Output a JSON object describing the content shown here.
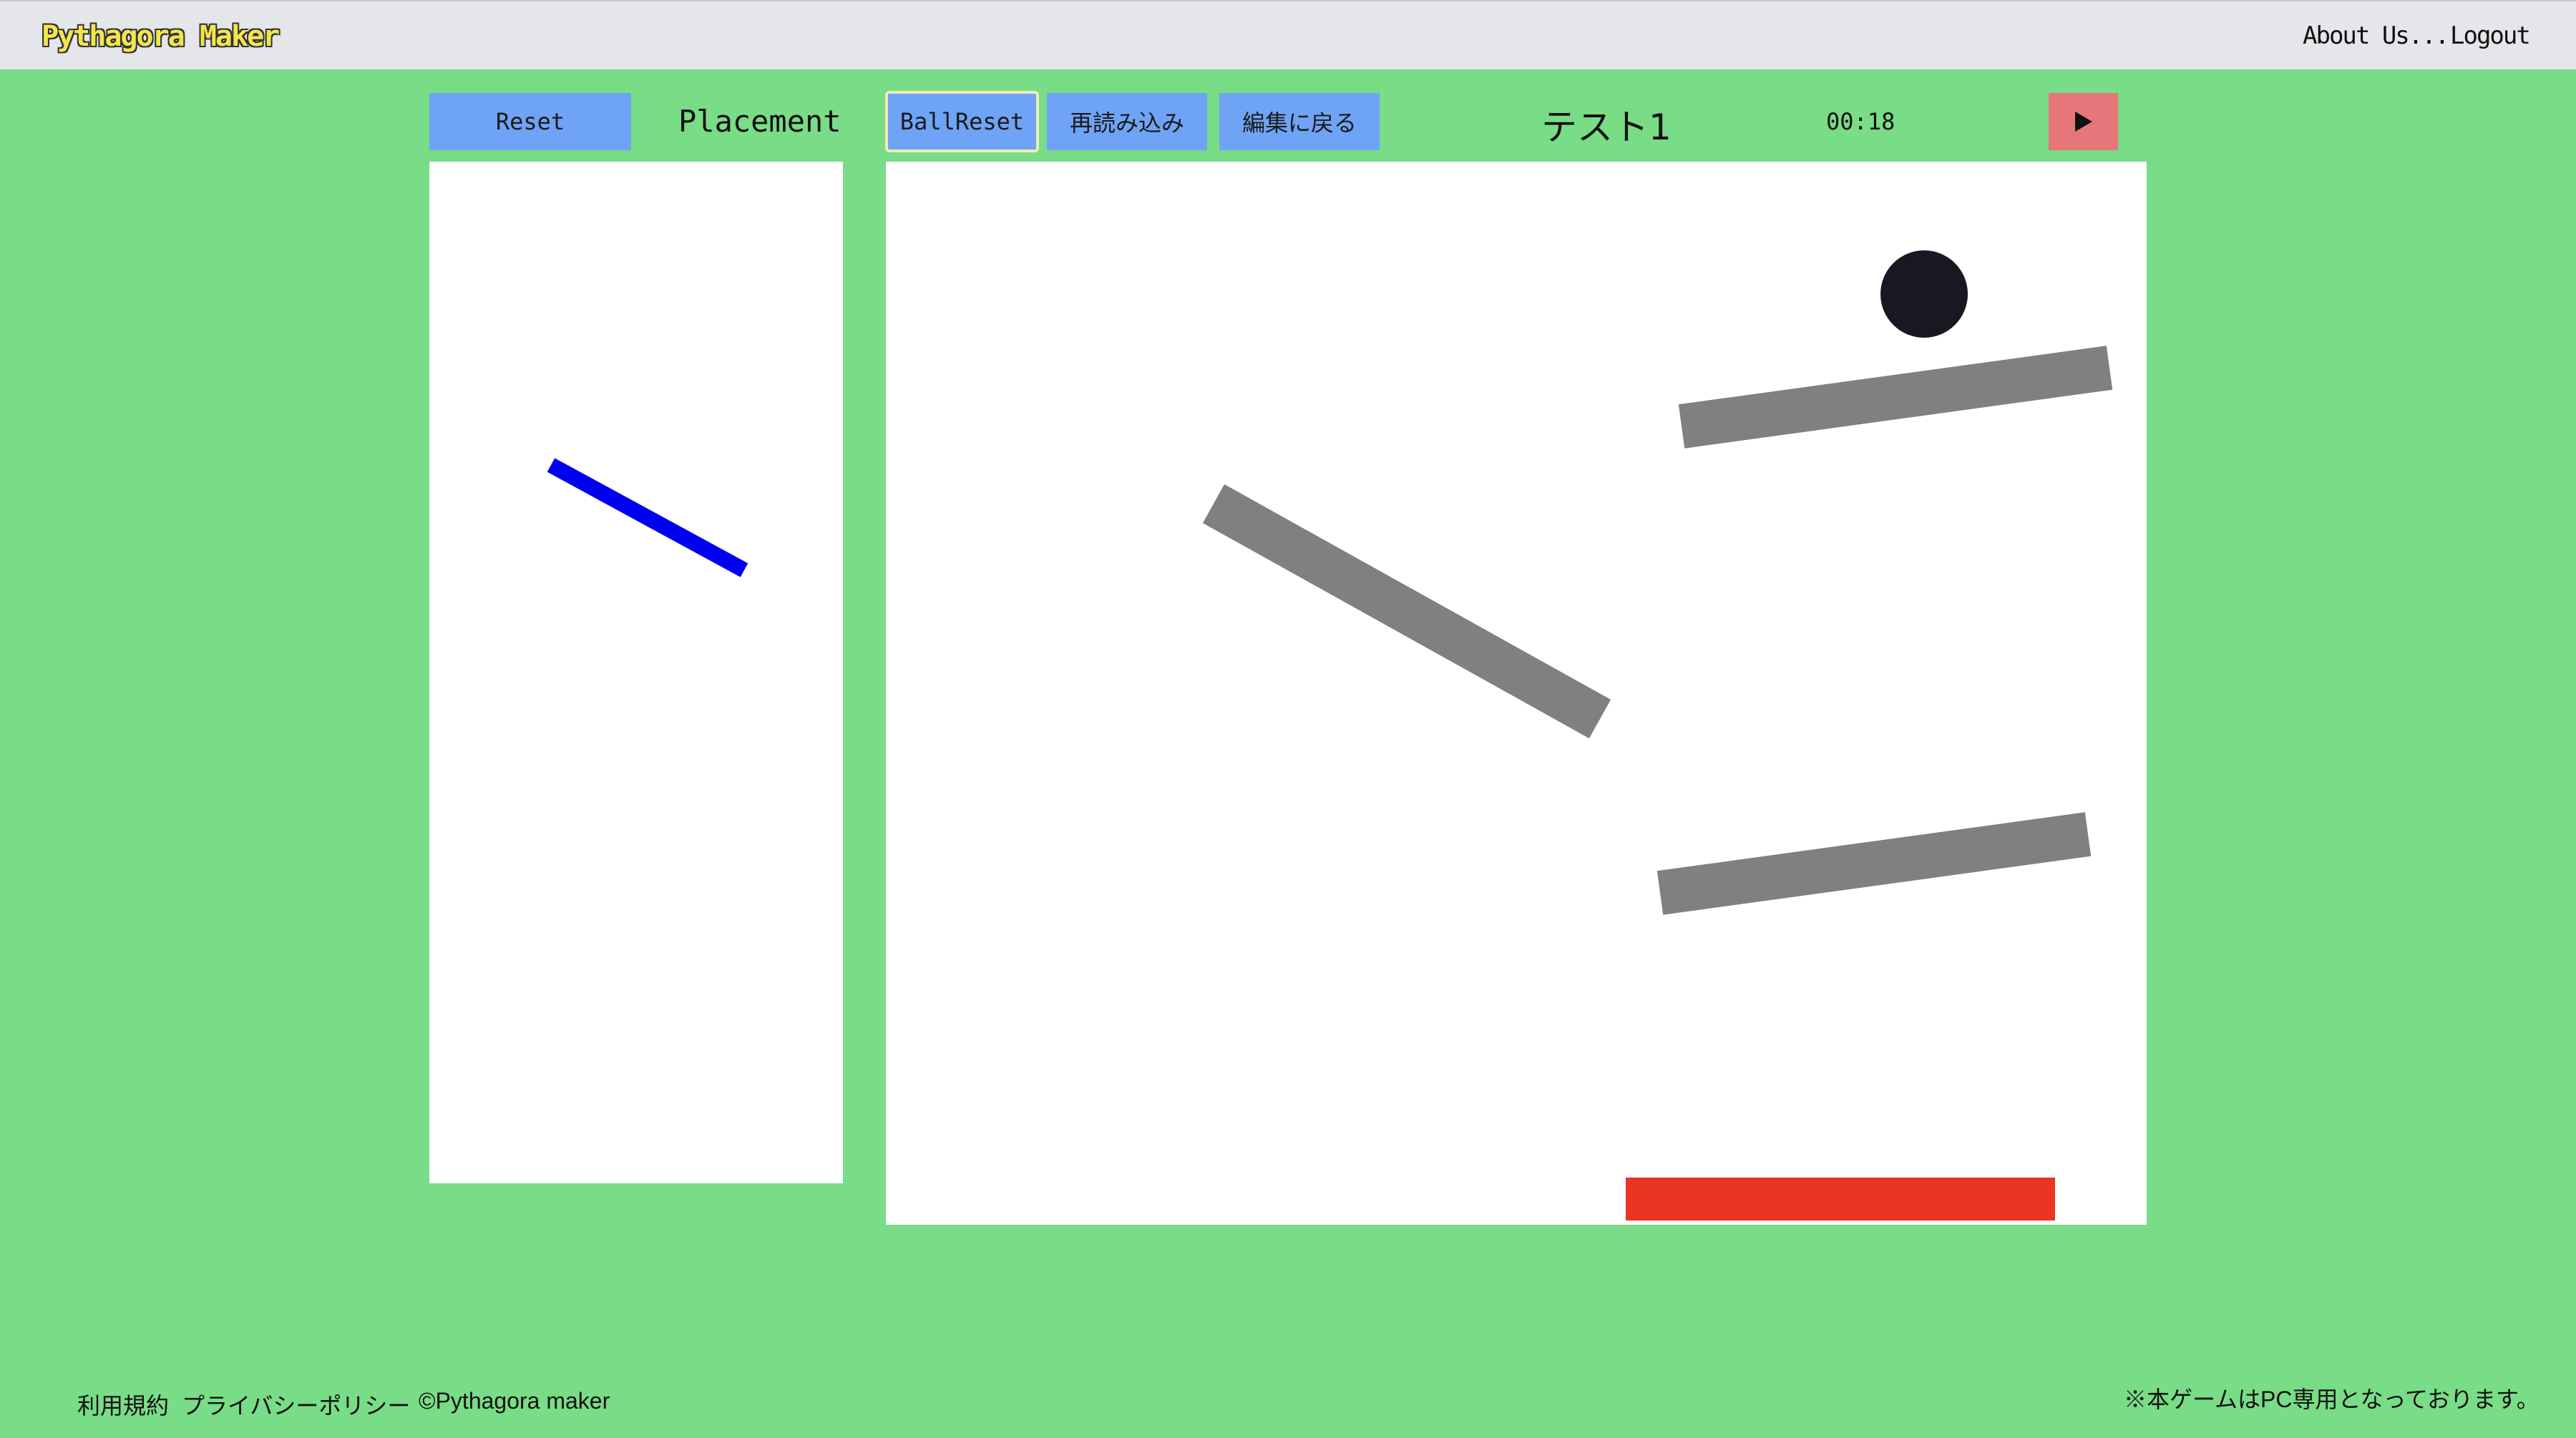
{
  "header": {
    "logo": "Pythagora Maker",
    "nav": {
      "about": "About Us...",
      "logout": "Logout"
    }
  },
  "parts_panel": {
    "reset_label": "Reset",
    "title": "Placement"
  },
  "toolbar": {
    "ball_reset_label": "BallReset",
    "reload_label": "再読み込み",
    "back_to_edit_label": "編集に戻る",
    "stage_name": "テスト1",
    "timer": "00:18",
    "play_icon": "play-icon"
  },
  "colors": {
    "background": "#79dc86",
    "header": "#e5e6ea",
    "button": "#6fa3f5",
    "play_button": "#e5767a",
    "placed_bar": "#0000f0",
    "obstacle": "#808080",
    "ball": "#171822",
    "goal": "#ea3424"
  },
  "footer": {
    "terms": "利用規約",
    "privacy": "プライバシーポリシー",
    "copyright": "©Pythagora maker",
    "pc_notice": "※本ゲームはPC専用となっております。"
  }
}
